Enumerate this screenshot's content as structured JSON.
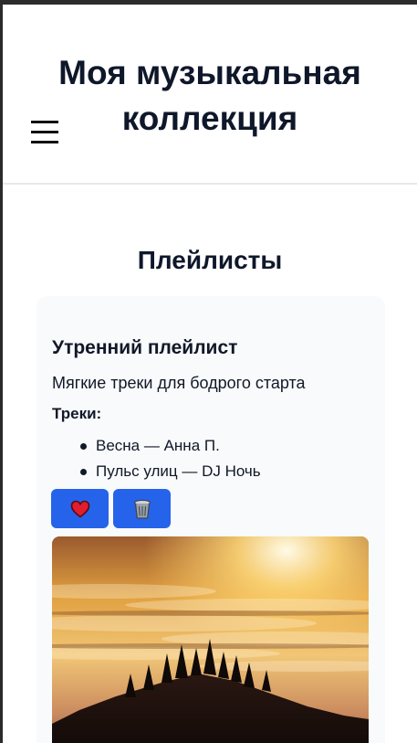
{
  "header": {
    "title": "Моя музыкальная коллекция",
    "menu_icon": "hamburger-menu-icon"
  },
  "section": {
    "title": "Плейлисты"
  },
  "playlist": {
    "name": "Утренний плейлист",
    "description": "Мягкие треки для бодрого старта",
    "tracks_label": "Треки:",
    "tracks": [
      "Весна — Анна П.",
      "Пульс улиц — DJ Ночь"
    ],
    "like_icon": "heart-icon",
    "delete_icon": "trash-icon",
    "cover_image": "sunrise-over-clouds-image"
  },
  "colors": {
    "accent": "#2563eb",
    "card_bg": "#f8fafc",
    "text": "#0f172a"
  }
}
